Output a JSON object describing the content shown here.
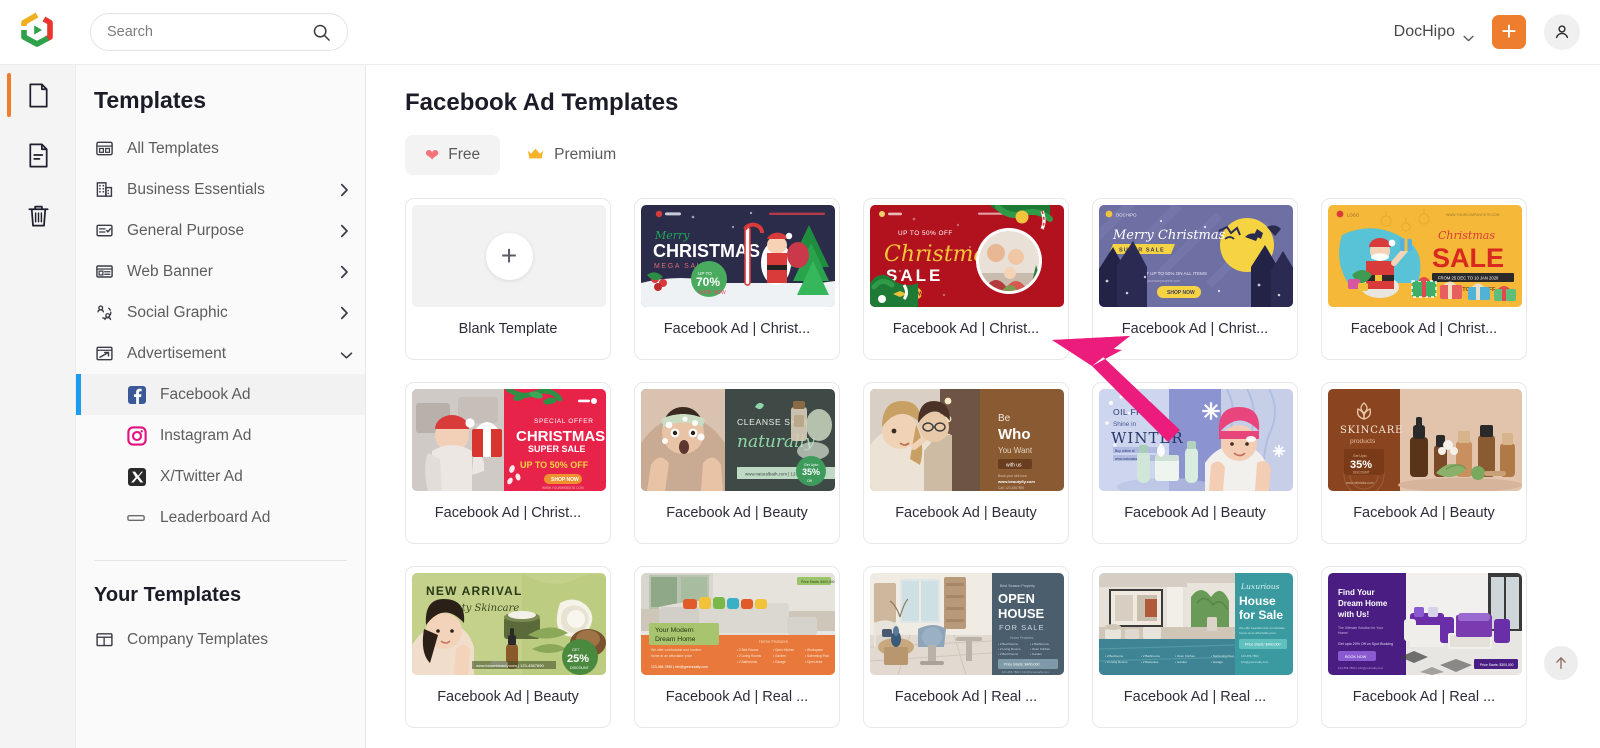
{
  "header": {
    "logo_icon": "dochipo-logo-icon",
    "search": {
      "placeholder": "Search",
      "value": "",
      "icon": "search-icon"
    },
    "brand_label": "DocHipo",
    "brand_caret_icon": "chevron-down-icon",
    "create_button_label": "+",
    "account_icon": "user-avatar-icon"
  },
  "rail": {
    "items": [
      {
        "name": "documents",
        "icon": "file-blank-icon",
        "active": true
      },
      {
        "name": "my-documents",
        "icon": "file-lines-icon",
        "active": false
      },
      {
        "name": "trash",
        "icon": "trash-icon",
        "active": false
      }
    ]
  },
  "sidebar": {
    "title": "Templates",
    "items": [
      {
        "label": "All Templates",
        "icon": "grid-layout-icon",
        "expandable": false
      },
      {
        "label": "Business Essentials",
        "icon": "building-icon",
        "expandable": true,
        "expanded": false
      },
      {
        "label": "General Purpose",
        "icon": "checklist-icon",
        "expandable": true,
        "expanded": false
      },
      {
        "label": "Web Banner",
        "icon": "web-banner-icon",
        "expandable": true,
        "expanded": false
      },
      {
        "label": "Social Graphic",
        "icon": "social-graphic-icon",
        "expandable": true,
        "expanded": false
      },
      {
        "label": "Advertisement",
        "icon": "advertisement-icon",
        "expandable": true,
        "expanded": true
      }
    ],
    "sub_items": [
      {
        "label": "Facebook Ad",
        "icon": "facebook-icon",
        "active": true
      },
      {
        "label": "Instagram Ad",
        "icon": "instagram-icon",
        "active": false
      },
      {
        "label": "X/Twitter Ad",
        "icon": "x-twitter-icon",
        "active": false
      },
      {
        "label": "Leaderboard Ad",
        "icon": "leaderboard-icon",
        "active": false
      }
    ],
    "your_templates_title": "Your Templates",
    "your_templates_items": [
      {
        "label": "Company Templates",
        "icon": "company-templates-icon"
      }
    ]
  },
  "main": {
    "page_title": "Facebook Ad Templates",
    "tabs": [
      {
        "label": "Free",
        "icon": "heart-icon",
        "glyph": "❤",
        "active": true
      },
      {
        "label": "Premium",
        "icon": "crown-icon",
        "glyph": "👑",
        "active": false
      }
    ],
    "cards": [
      {
        "label": "Blank Template",
        "kind": "blank",
        "plus_glyph": "+"
      },
      {
        "label": "Facebook Ad | Christ...",
        "kind": "thumb",
        "thumb": "xmas-navy-santa"
      },
      {
        "label": "Facebook Ad | Christ...",
        "kind": "thumb",
        "thumb": "xmas-red-sale"
      },
      {
        "label": "Facebook Ad | Christ...",
        "kind": "thumb",
        "thumb": "xmas-sleigh-night"
      },
      {
        "label": "Facebook Ad | Christ...",
        "kind": "thumb",
        "thumb": "xmas-yellow-sale"
      },
      {
        "label": "Facebook Ad | Christ...",
        "kind": "thumb",
        "thumb": "xmas-gift-woman"
      },
      {
        "label": "Facebook Ad | Beauty",
        "kind": "thumb",
        "thumb": "beauty-cleanse-skin"
      },
      {
        "label": "Facebook Ad | Beauty",
        "kind": "thumb",
        "thumb": "beauty-be-who"
      },
      {
        "label": "Facebook Ad | Beauty",
        "kind": "thumb",
        "thumb": "beauty-oil-free-winter"
      },
      {
        "label": "Facebook Ad | Beauty",
        "kind": "thumb",
        "thumb": "beauty-skincare-products"
      },
      {
        "label": "Facebook Ad | Beauty",
        "kind": "thumb",
        "thumb": "beauty-new-arrival"
      },
      {
        "label": "Facebook Ad | Real ...",
        "kind": "thumb",
        "thumb": "realestate-modern-dream"
      },
      {
        "label": "Facebook Ad | Real ...",
        "kind": "thumb",
        "thumb": "realestate-open-house"
      },
      {
        "label": "Facebook Ad | Real ...",
        "kind": "thumb",
        "thumb": "realestate-luxurious"
      },
      {
        "label": "Facebook Ad | Real ...",
        "kind": "thumb",
        "thumb": "realestate-purple-dream"
      }
    ],
    "scroll_top_icon": "arrow-up-icon"
  },
  "annotation": {
    "arrow_icon": "pointer-arrow-icon",
    "color": "#ec1c7d",
    "points_at": "Facebook Ad | Christ..."
  },
  "colors": {
    "accent_orange": "#ef7d2e",
    "active_blue": "#1d9bf0",
    "facebook_blue": "#3b5998",
    "annotation_pink": "#ec1c7d",
    "heart_red": "#f4737b",
    "crown_gold": "#f5b327"
  }
}
